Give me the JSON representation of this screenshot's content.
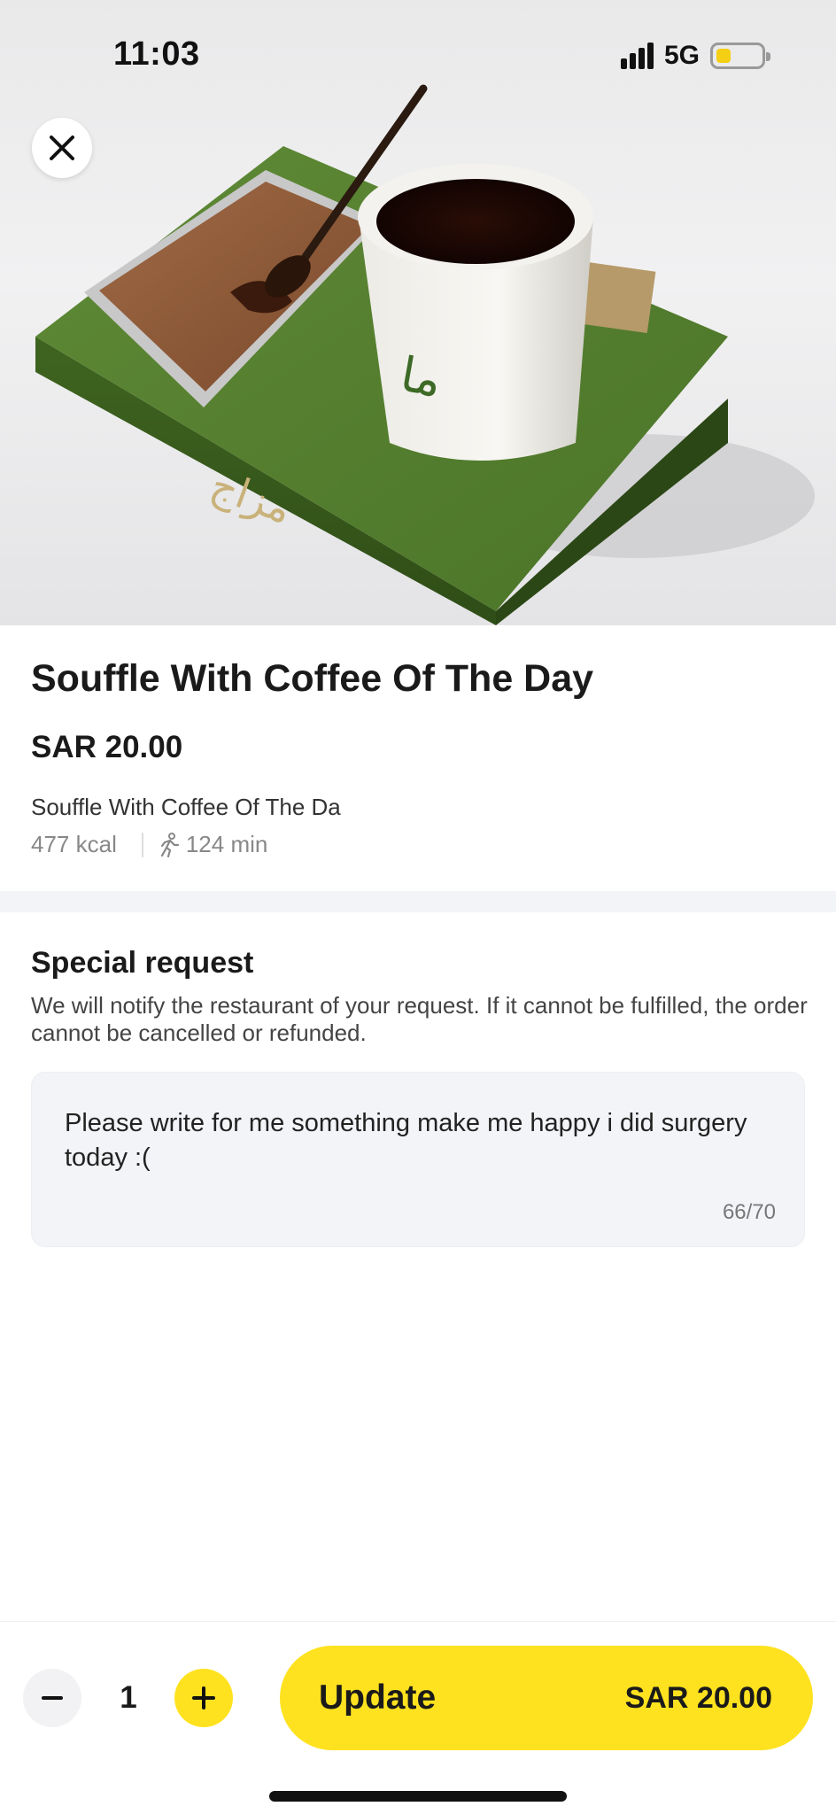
{
  "status_bar": {
    "time": "11:03",
    "network": "5G",
    "battery_color": "#f5cf14"
  },
  "header": {
    "close_icon": "close-icon"
  },
  "product": {
    "name": "Souffle With Coffee Of The Day",
    "price": "SAR 20.00",
    "description": "Souffle With Coffee Of The Da",
    "calories": "477 kcal",
    "walk_time": "124 min"
  },
  "special_request": {
    "title": "Special request",
    "note": "We will notify the restaurant of your request. If it cannot be fulfilled, the order cannot be cancelled or refunded.",
    "text": "Please write for me something make me happy i did surgery today :(",
    "counter": "66/70"
  },
  "footer": {
    "quantity": "1",
    "update_label": "Update",
    "update_price": "SAR 20.00",
    "accent_color": "#ffe21f"
  }
}
